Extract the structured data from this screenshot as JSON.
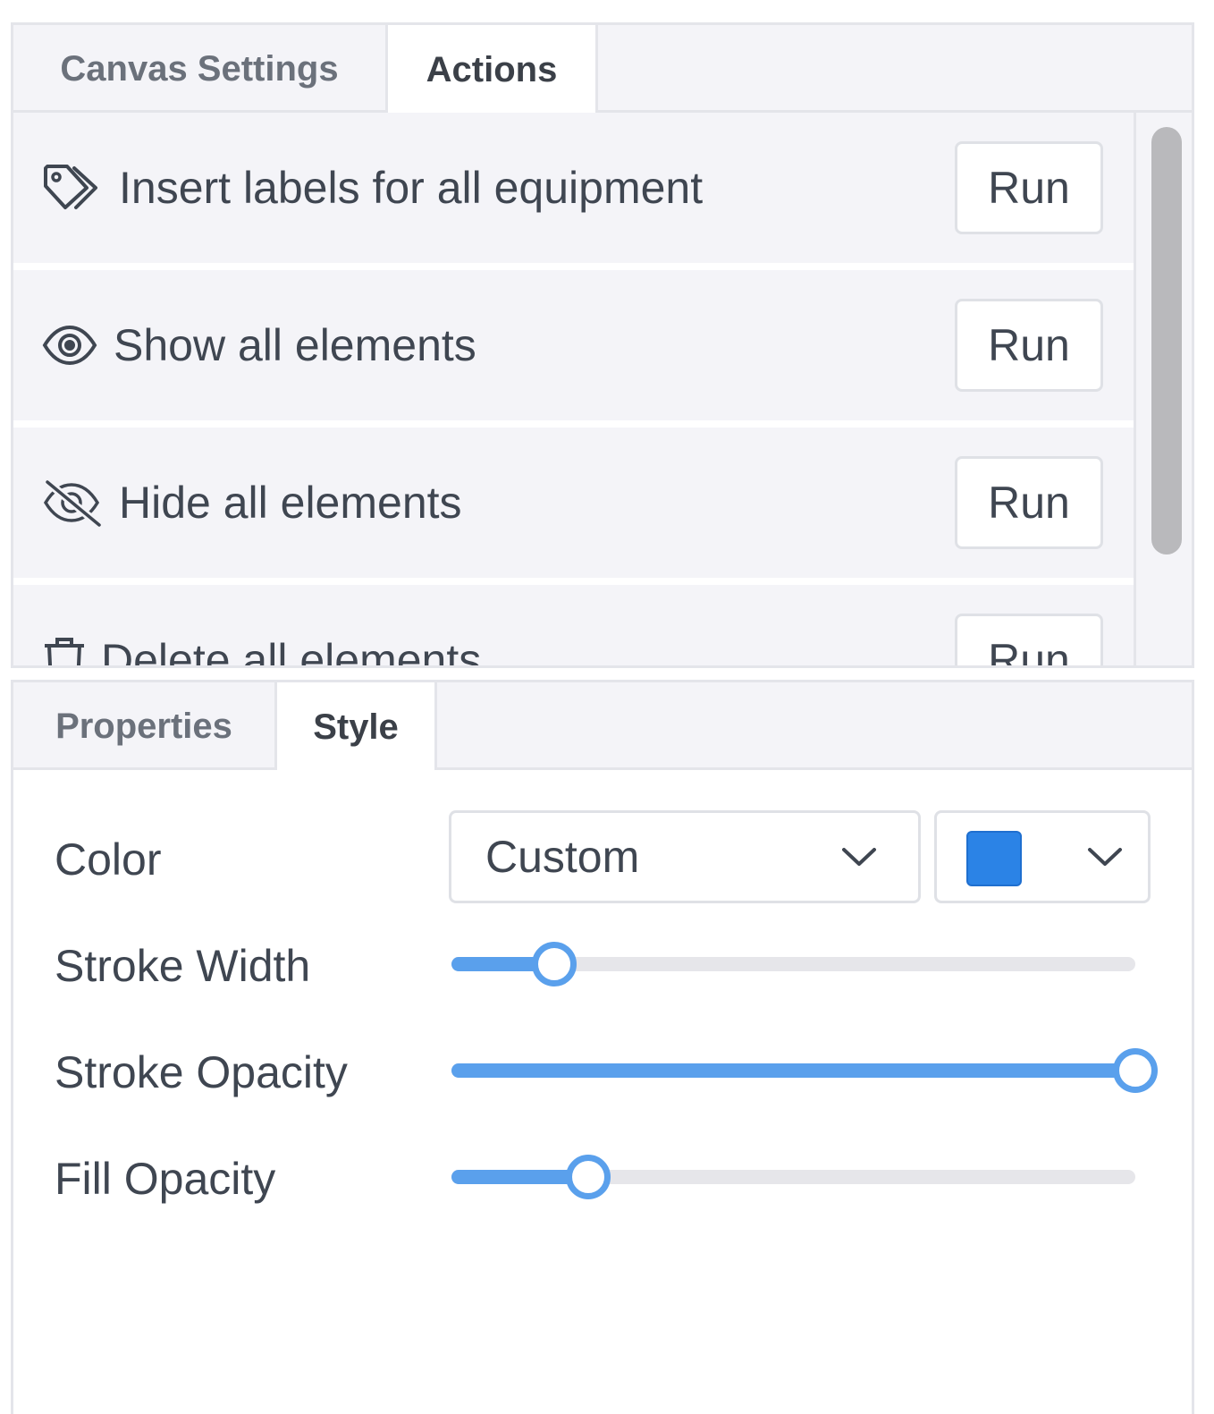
{
  "top_panel": {
    "tabs": [
      {
        "label": "Canvas Settings",
        "active": false
      },
      {
        "label": "Actions",
        "active": true
      }
    ],
    "actions": [
      {
        "icon": "tag-icon",
        "label": "Insert labels for all equipment",
        "button": "Run"
      },
      {
        "icon": "eye-icon",
        "label": "Show all elements",
        "button": "Run"
      },
      {
        "icon": "eye-slash-icon",
        "label": "Hide all elements",
        "button": "Run"
      },
      {
        "icon": "trash-icon",
        "label": "Delete all elements",
        "button": "Run"
      }
    ]
  },
  "bottom_panel": {
    "tabs": [
      {
        "label": "Properties",
        "active": false
      },
      {
        "label": "Style",
        "active": true
      }
    ],
    "style": {
      "color_label": "Color",
      "color_select_value": "Custom",
      "color_swatch": "#2b83e6",
      "stroke_width_label": "Stroke Width",
      "stroke_width_fraction": 0.15,
      "stroke_opacity_label": "Stroke Opacity",
      "stroke_opacity_fraction": 1.0,
      "fill_opacity_label": "Fill Opacity",
      "fill_opacity_fraction": 0.2
    }
  },
  "colors": {
    "accent": "#5aa0ec",
    "panel_bg": "#f4f4f8",
    "border": "#e4e5ea",
    "text": "#3f4651"
  }
}
